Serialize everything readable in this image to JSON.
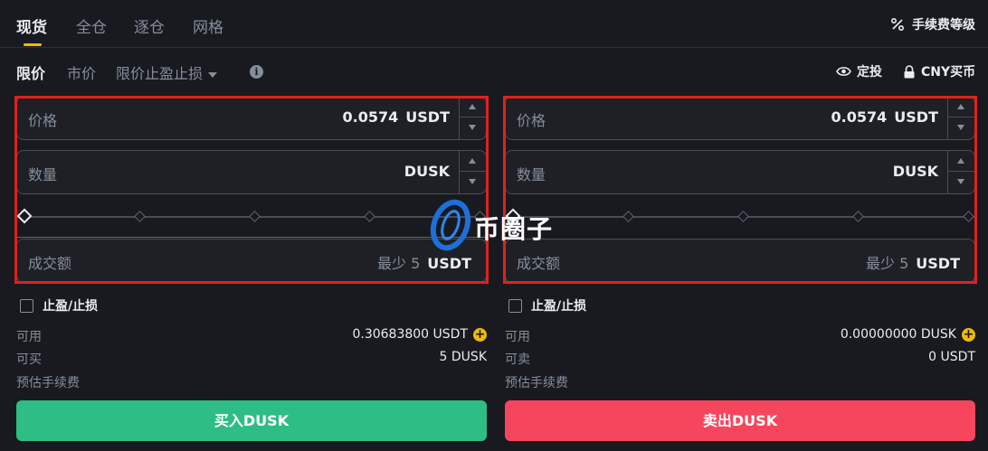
{
  "tabs": [
    {
      "label": "现货",
      "active": true
    },
    {
      "label": "全仓",
      "active": false
    },
    {
      "label": "逐仓",
      "active": false
    },
    {
      "label": "网格",
      "active": false
    }
  ],
  "fee_level": {
    "label": "手续费等级",
    "icon": "percent-icon"
  },
  "order_types": [
    {
      "label": "限价",
      "active": true
    },
    {
      "label": "市价",
      "active": false
    },
    {
      "label": "限价止盈止损",
      "active": false
    }
  ],
  "links": {
    "auto_invest": {
      "label": "定投",
      "icon": "eye-icon"
    },
    "cny_buy": {
      "label": "CNY买币",
      "icon": "lock-icon"
    }
  },
  "buy": {
    "price_label": "价格",
    "price_value": "0.0574",
    "price_unit": "USDT",
    "amount_label": "数量",
    "amount_unit": "DUSK",
    "total_label": "成交额",
    "total_hint": "最少 5",
    "total_unit": "USDT",
    "tpsl_label": "止盈/止损",
    "available_label": "可用",
    "available_value": "0.30683800 USDT",
    "max_label": "可买",
    "max_value": "5 DUSK",
    "fee_label": "预估手续费",
    "button_label": "买入DUSK",
    "slider_percent": 0
  },
  "sell": {
    "price_label": "价格",
    "price_value": "0.0574",
    "price_unit": "USDT",
    "amount_label": "数量",
    "amount_unit": "DUSK",
    "total_label": "成交额",
    "total_hint": "最少 5",
    "total_unit": "USDT",
    "tpsl_label": "止盈/止损",
    "available_label": "可用",
    "available_value": "0.00000000 DUSK",
    "max_label": "可卖",
    "max_value": "0 USDT",
    "fee_label": "预估手续费",
    "button_label": "卖出DUSK",
    "slider_percent": 0
  },
  "watermark": {
    "text": "币圈子"
  },
  "colors": {
    "background": "#181a20",
    "accent": "#f0b90b",
    "buy": "#2ebd85",
    "sell": "#f6465d",
    "highlight_box": "#e0211d"
  }
}
